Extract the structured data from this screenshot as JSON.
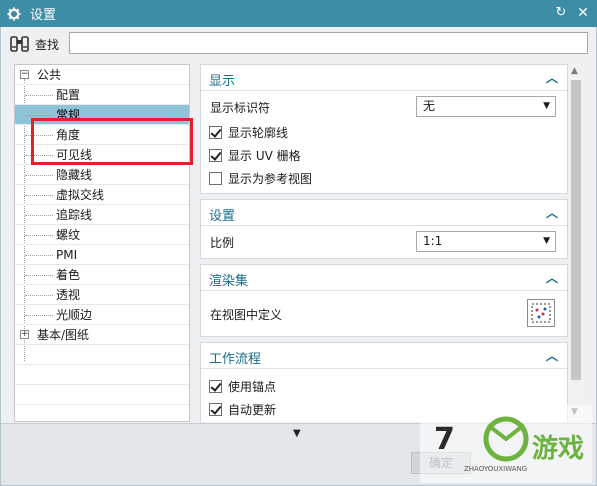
{
  "window": {
    "title": "设置",
    "title_icon": "gear-icon",
    "reset_icon": "reset-icon",
    "close_icon": "close-icon"
  },
  "search": {
    "icon": "binoculars-icon",
    "label": "查找",
    "value": "",
    "placeholder": ""
  },
  "tree": {
    "items": [
      {
        "label": "公共",
        "expander": "−"
      },
      {
        "label": "配置"
      },
      {
        "label": "常规"
      },
      {
        "label": "角度"
      },
      {
        "label": "可见线"
      },
      {
        "label": "隐藏线"
      },
      {
        "label": "虚拟交线"
      },
      {
        "label": "追踪线"
      },
      {
        "label": "螺纹"
      },
      {
        "label": "PMI"
      },
      {
        "label": "着色"
      },
      {
        "label": "透视"
      },
      {
        "label": "光顺边"
      },
      {
        "label": "基本/图纸",
        "expander": "+"
      }
    ],
    "selected": "常规"
  },
  "sections": {
    "display": {
      "title": "显示",
      "show_marker_label": "显示标识符",
      "show_marker_value": "无",
      "checks": [
        {
          "label": "显示轮廓线",
          "checked": true
        },
        {
          "label": "显示 UV 栅格",
          "checked": true
        },
        {
          "label": "显示为参考视图",
          "checked": false
        }
      ]
    },
    "settings": {
      "title": "设置",
      "scale_label": "比例",
      "scale_value": "1:1"
    },
    "render_set": {
      "title": "渲染集",
      "define_label": "在视图中定义"
    },
    "workflow": {
      "title": "工作流程",
      "checks": [
        {
          "label": "使用锚点",
          "checked": true
        },
        {
          "label": "自动更新",
          "checked": true
        }
      ]
    }
  },
  "footer": {
    "more_icon": "more-down-icon",
    "ok_label": "确定"
  },
  "watermark": {
    "text": "游戏",
    "sub": "ZHAOYOUXIWANG"
  },
  "colors": {
    "titlebar": "#3d8da6",
    "section_title": "#1b6e89",
    "selection": "#8ec3d8",
    "highlight": "#e0202a"
  }
}
